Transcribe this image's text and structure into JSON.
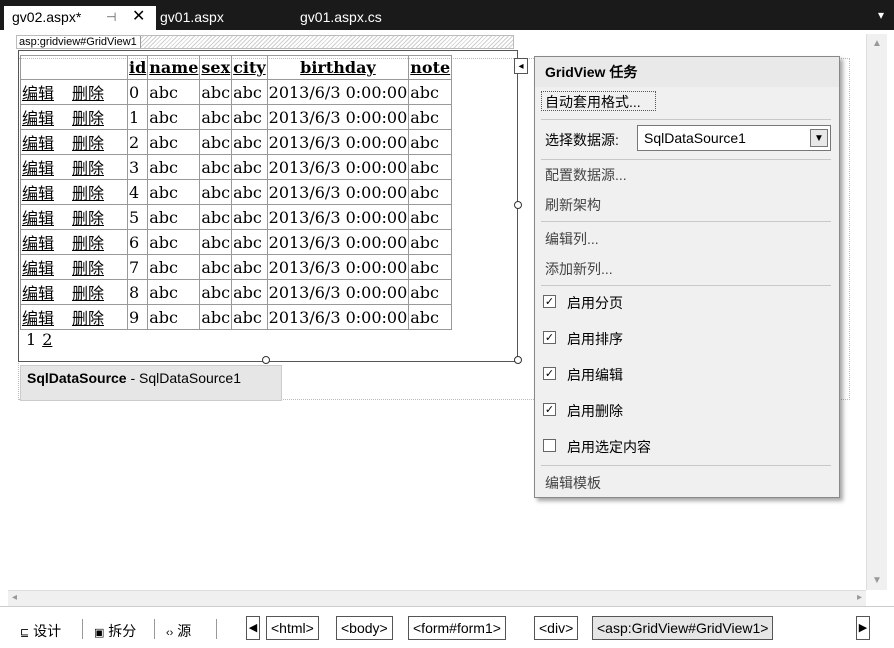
{
  "tabs": [
    {
      "label": "gv02.aspx*",
      "active": true
    },
    {
      "label": "gv01.aspx",
      "active": false
    },
    {
      "label": "gv01.aspx.cs",
      "active": false
    }
  ],
  "icons": {
    "pin": "⊣",
    "close": "✕",
    "dropdown": "▾"
  },
  "gridview_tag": "asp:gridview#GridView1",
  "grid": {
    "columns": [
      "",
      "id",
      "name",
      "sex",
      "city",
      "birthday",
      "note"
    ],
    "edit_label": "编辑",
    "delete_label": "删除",
    "rows": [
      [
        "0",
        "abc",
        "abc",
        "abc",
        "2013/6/3 0:00:00",
        "abc"
      ],
      [
        "1",
        "abc",
        "abc",
        "abc",
        "2013/6/3 0:00:00",
        "abc"
      ],
      [
        "2",
        "abc",
        "abc",
        "abc",
        "2013/6/3 0:00:00",
        "abc"
      ],
      [
        "3",
        "abc",
        "abc",
        "abc",
        "2013/6/3 0:00:00",
        "abc"
      ],
      [
        "4",
        "abc",
        "abc",
        "abc",
        "2013/6/3 0:00:00",
        "abc"
      ],
      [
        "5",
        "abc",
        "abc",
        "abc",
        "2013/6/3 0:00:00",
        "abc"
      ],
      [
        "6",
        "abc",
        "abc",
        "abc",
        "2013/6/3 0:00:00",
        "abc"
      ],
      [
        "7",
        "abc",
        "abc",
        "abc",
        "2013/6/3 0:00:00",
        "abc"
      ],
      [
        "8",
        "abc",
        "abc",
        "abc",
        "2013/6/3 0:00:00",
        "abc"
      ],
      [
        "9",
        "abc",
        "abc",
        "abc",
        "2013/6/3 0:00:00",
        "abc"
      ]
    ],
    "pager": [
      "1",
      "2"
    ]
  },
  "datasource": {
    "type": "SqlDataSource",
    "separator": " - ",
    "id": "SqlDataSource1"
  },
  "task_panel": {
    "title": "GridView 任务",
    "auto_format": "自动套用格式...",
    "choose_ds_label": "选择数据源:",
    "choose_ds_value": "SqlDataSource1",
    "configure_ds": "配置数据源...",
    "refresh_schema": "刷新架构",
    "edit_columns": "编辑列...",
    "add_column": "添加新列...",
    "options": [
      {
        "label": "启用分页",
        "checked": true
      },
      {
        "label": "启用排序",
        "checked": true
      },
      {
        "label": "启用编辑",
        "checked": true
      },
      {
        "label": "启用删除",
        "checked": true
      },
      {
        "label": "启用选定内容",
        "checked": false
      }
    ],
    "edit_templates": "编辑模板"
  },
  "bottom": {
    "views": [
      {
        "icon": "⊑",
        "label": "设计"
      },
      {
        "icon": "▣",
        "label": "拆分"
      },
      {
        "icon": "‹›",
        "label": "源"
      }
    ],
    "breadcrumbs": [
      "<html>",
      "<body>",
      "<form#form1>",
      "<div>",
      "<asp:GridView#GridView1>"
    ]
  }
}
